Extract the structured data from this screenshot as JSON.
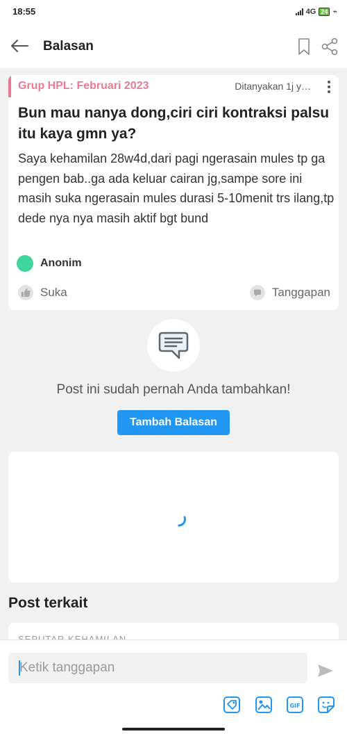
{
  "status_bar": {
    "time": "18:55",
    "network": "4G",
    "battery": "24"
  },
  "app_bar": {
    "title": "Balasan",
    "icons": [
      "back-arrow-icon",
      "bookmark-icon",
      "share-icon"
    ]
  },
  "question": {
    "group": "Grup HPL: Februari 2023",
    "asked": "Ditanyakan 1j y…",
    "title": "Bun mau nanya dong,ciri ciri kontraksi palsu itu kaya gmn ya?",
    "body": "Saya kehamilan 28w4d,dari pagi ngerasain mules tp ga pengen bab..ga ada keluar cairan jg,sampe sore ini masih suka ngerasain mules durasi 5-10menit trs ilang,tp dede nya nya masih aktif bgt bund",
    "author": "Anonim",
    "like_label": "Suka",
    "reply_label": "Tanggapan"
  },
  "empty_state": {
    "message": "Post ini sudah pernah Anda tambahkan!",
    "button_label": "Tambah Balasan"
  },
  "related": {
    "title": "Post terkait",
    "first_category": "SEPUTAR KEHAMILAN"
  },
  "composer": {
    "placeholder": "Ketik tanggapan",
    "tools": [
      "tag-icon",
      "image-icon",
      "gif-icon",
      "sticker-icon"
    ]
  },
  "colors": {
    "accent_pink": "#e97b97",
    "primary_blue": "#2196f3",
    "avatar_green": "#3fd59b",
    "background": "#f1f1f2"
  }
}
